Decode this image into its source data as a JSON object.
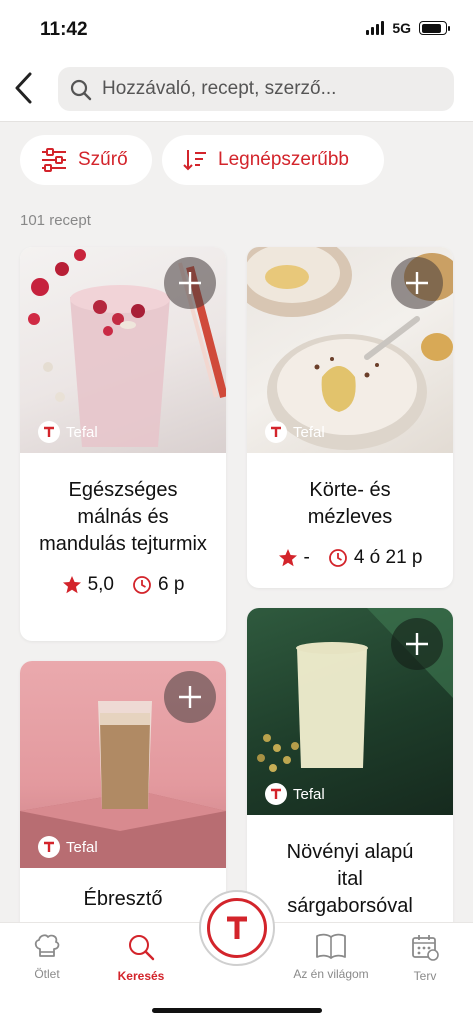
{
  "status": {
    "time": "11:42",
    "network": "5G"
  },
  "search": {
    "placeholder": "Hozzávaló, recept, szerző..."
  },
  "chips": {
    "filter": "Szűrő",
    "sort": "Legnépszerűbb"
  },
  "result_count": "101 recept",
  "cards": [
    {
      "title": "Egészséges málnás és mandulás tejturmix",
      "brand": "Tefal",
      "rating": "5,0",
      "time": "6 p"
    },
    {
      "title": "Körte- és mézleves",
      "brand": "Tefal",
      "rating": "-",
      "time": "4 ó 21 p"
    },
    {
      "title": "Ébresztő",
      "brand": "Tefal"
    },
    {
      "title": "Növényi alapú ital sárgaborsóval",
      "brand": "Tefal"
    }
  ],
  "nav": {
    "idea": "Ötlet",
    "search": "Keresés",
    "world": "Az én világom",
    "plan": "Terv"
  },
  "colors": {
    "accent": "#d3242b",
    "background": "#f2f1f0"
  }
}
